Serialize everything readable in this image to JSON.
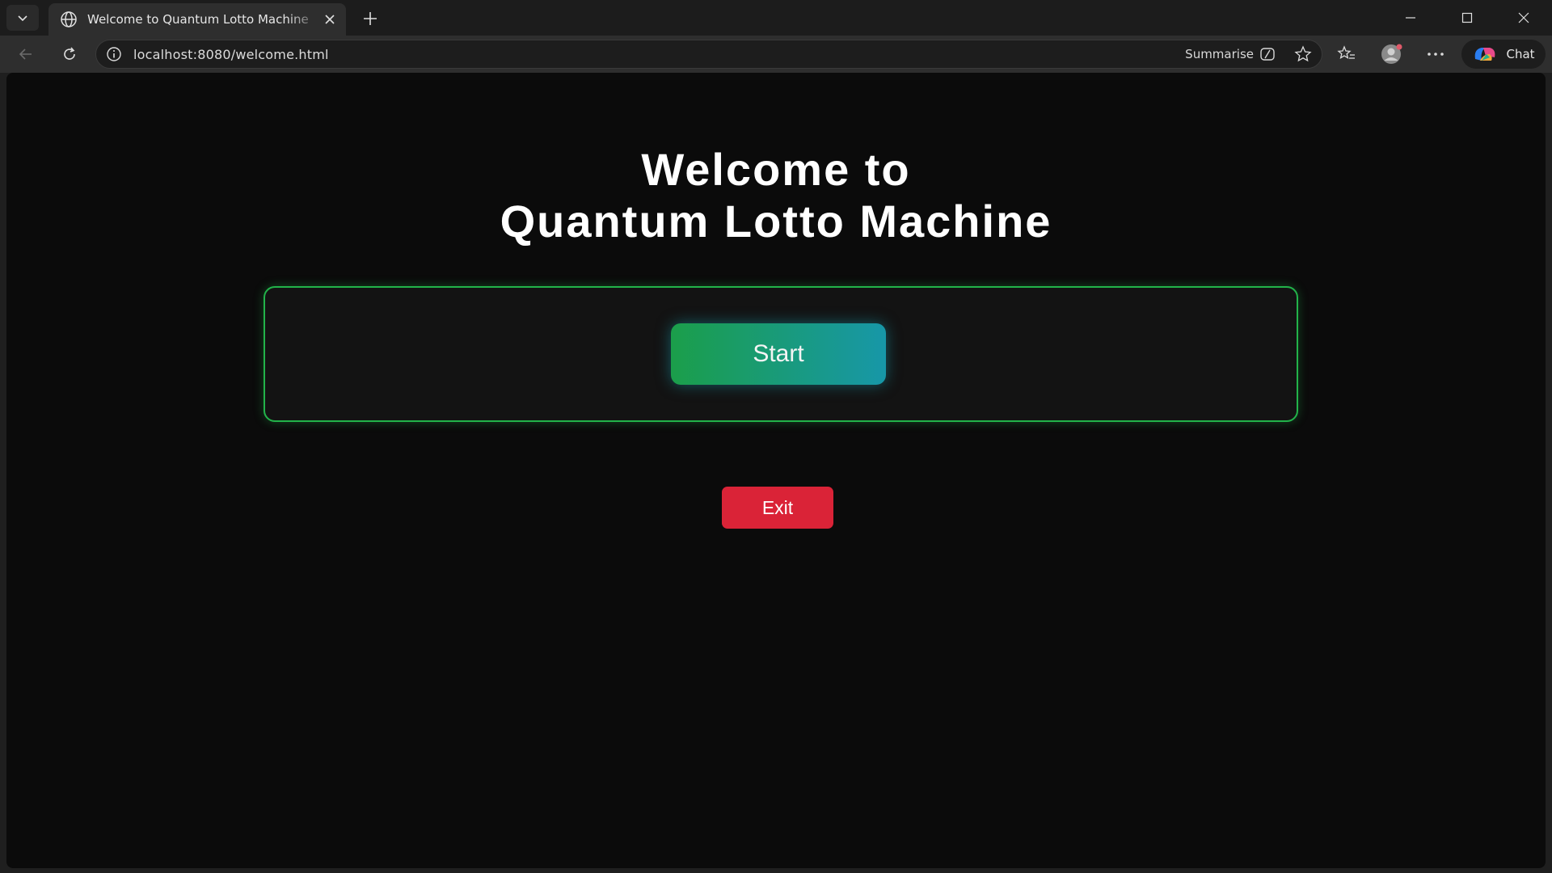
{
  "browser": {
    "tab": {
      "title": "Welcome to Quantum Lotto Machine"
    },
    "address_bar": {
      "url": "localhost:8080/welcome.html"
    },
    "summarise_label": "Summarise",
    "chat_label": "Chat"
  },
  "page": {
    "heading_line1": "Welcome to",
    "heading_line2": "Quantum Lotto Machine",
    "start_label": "Start",
    "exit_label": "Exit"
  },
  "colors": {
    "page_background": "#0b0b0b",
    "panel_border": "#22b34a",
    "start_gradient_from": "#1b9e4a",
    "start_gradient_to": "#1797a8",
    "exit_button": "#da2337"
  }
}
